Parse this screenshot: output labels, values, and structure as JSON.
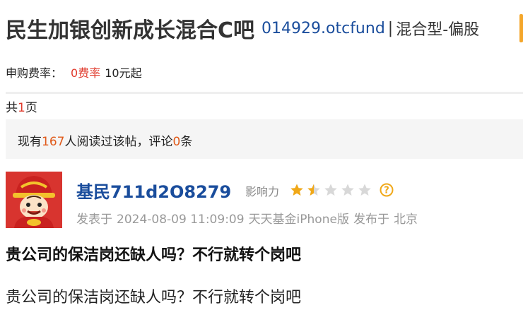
{
  "header": {
    "title": "民生加银创新成长混合C吧",
    "fund_code": "014929.otcfund",
    "separator": "|",
    "fund_type": "混合型-偏股"
  },
  "fee": {
    "label": "申购费率：",
    "rate": "0",
    "rate_label": "费率",
    "min_amount": "10元起"
  },
  "pagination": {
    "prefix": "共",
    "count": "1",
    "suffix": "页"
  },
  "stats": {
    "prefix": "现有",
    "readers": "167",
    "middle": "人阅读过该帖，评论",
    "comments": "0",
    "suffix": "条"
  },
  "author": {
    "avatar_icon": "fortune-god-avatar-icon",
    "name": "基民711d2O8279",
    "influence_label": "影响力",
    "influence_stars": 1.5,
    "influence_max": 5,
    "help_icon": "question-mark-icon"
  },
  "meta": {
    "posted_prefix": "发表于",
    "datetime": "2024-08-09 11:09:09",
    "client": "天天基金iPhone版",
    "location_prefix": "发布于",
    "location": "北京"
  },
  "post": {
    "title": "贵公司的保洁岗还缺人吗？不行就转个岗吧",
    "body": "贵公司的保洁岗还缺人吗？不行就转个岗吧"
  },
  "colors": {
    "link_blue": "#1a4d9c",
    "highlight_red": "#e0392b",
    "star_gold": "#f0a818",
    "star_grey": "#d8d8d8"
  }
}
